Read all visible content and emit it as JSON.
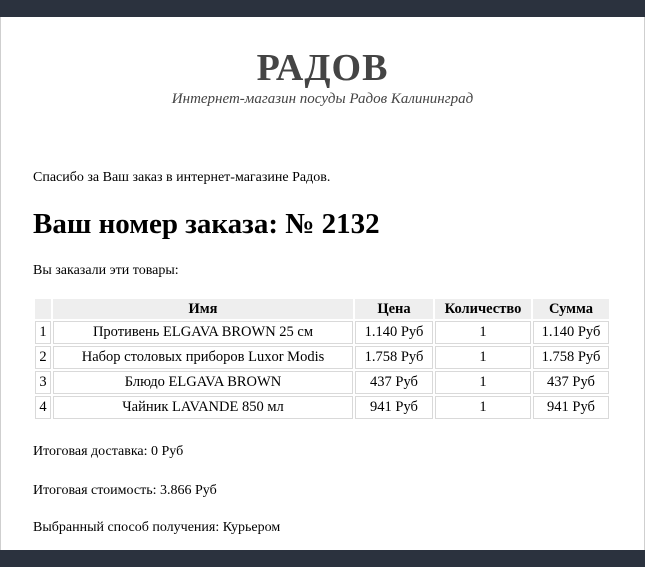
{
  "header": {
    "brand": "РАДОВ",
    "tagline": "Интернет-магазин посуды Радов Калининград"
  },
  "message": {
    "thanks": "Спасибо за Ваш заказ в интернет-магазине Радов.",
    "order_heading": "Ваш номер заказа: № 2132",
    "ordered_label": "Вы заказали эти товары:"
  },
  "table": {
    "headers": {
      "num": "",
      "name": "Имя",
      "price": "Цена",
      "qty": "Количество",
      "sum": "Сумма"
    },
    "rows": [
      {
        "num": "1",
        "name": "Противень ELGAVA BROWN 25 см",
        "price": "1.140 Руб",
        "qty": "1",
        "sum": "1.140 Руб"
      },
      {
        "num": "2",
        "name": "Набор столовых приборов Luxor Modis",
        "price": "1.758 Руб",
        "qty": "1",
        "sum": "1.758 Руб"
      },
      {
        "num": "3",
        "name": "Блюдо ELGAVA BROWN",
        "price": "437 Руб",
        "qty": "1",
        "sum": "437 Руб"
      },
      {
        "num": "4",
        "name": "Чайник LAVANDE 850 мл",
        "price": "941 Руб",
        "qty": "1",
        "sum": "941 Руб"
      }
    ]
  },
  "summary": {
    "delivery": "Итоговая доставка: 0 Руб",
    "total": "Итоговая стоимость: 3.866 Руб",
    "method": "Выбранный способ получения: Курьером"
  },
  "colors": {
    "bar": "#2b323e",
    "header_text": "#444444",
    "table_header_bg": "#eeeeee"
  }
}
